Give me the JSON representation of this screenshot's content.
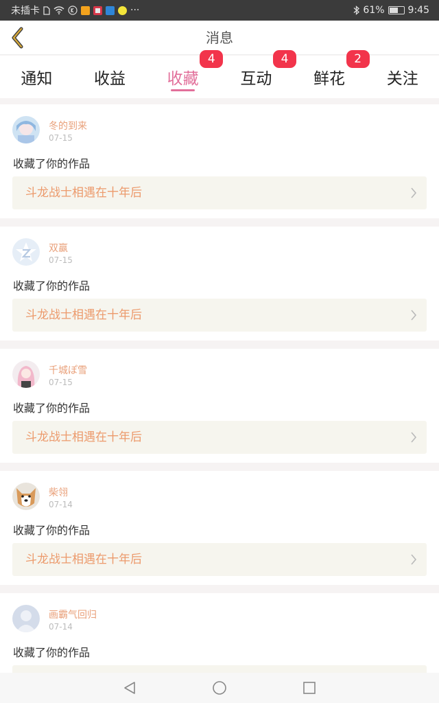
{
  "status_bar": {
    "carrier": "未插卡",
    "more": "···",
    "battery_percent": "61%",
    "battery_level": 0.61,
    "time": "9:45"
  },
  "header": {
    "title": "消息",
    "back_icon": "chevron-left-icon",
    "accent_color": "#d6a83a"
  },
  "tabs": [
    {
      "label": "通知",
      "badge": null,
      "active": false
    },
    {
      "label": "收益",
      "badge": null,
      "active": false
    },
    {
      "label": "收藏",
      "badge": "4",
      "active": true
    },
    {
      "label": "互动",
      "badge": "4",
      "active": false
    },
    {
      "label": "鲜花",
      "badge": "2",
      "active": false
    },
    {
      "label": "关注",
      "badge": null,
      "active": false
    }
  ],
  "colors": {
    "active_tab": "#e26f9a",
    "badge": "#f2344b",
    "username": "#e9a07a",
    "work_title": "#ec9a6c"
  },
  "items": [
    {
      "user": "冬的到来",
      "date": "07-15",
      "action": "收藏了你的作品",
      "work": "斗龙战士相遇在十年后",
      "avatar": "anime-avatar"
    },
    {
      "user": "双赢",
      "date": "07-15",
      "action": "收藏了你的作品",
      "work": "斗龙战士相遇在十年后",
      "avatar": "star-logo-avatar"
    },
    {
      "user": "千城ぽ雪",
      "date": "07-15",
      "action": "收藏了你的作品",
      "work": "斗龙战士相遇在十年后",
      "avatar": "pink-hair-avatar"
    },
    {
      "user": "柴翎",
      "date": "07-14",
      "action": "收藏了你的作品",
      "work": "斗龙战士相遇在十年后",
      "avatar": "dog-avatar"
    },
    {
      "user": "画霸气回归",
      "date": "07-14",
      "action": "收藏了你的作品",
      "work": "",
      "avatar": "default-avatar"
    }
  ],
  "navbar": {
    "back": "triangle-back-icon",
    "home": "circle-home-icon",
    "recents": "square-recents-icon"
  }
}
